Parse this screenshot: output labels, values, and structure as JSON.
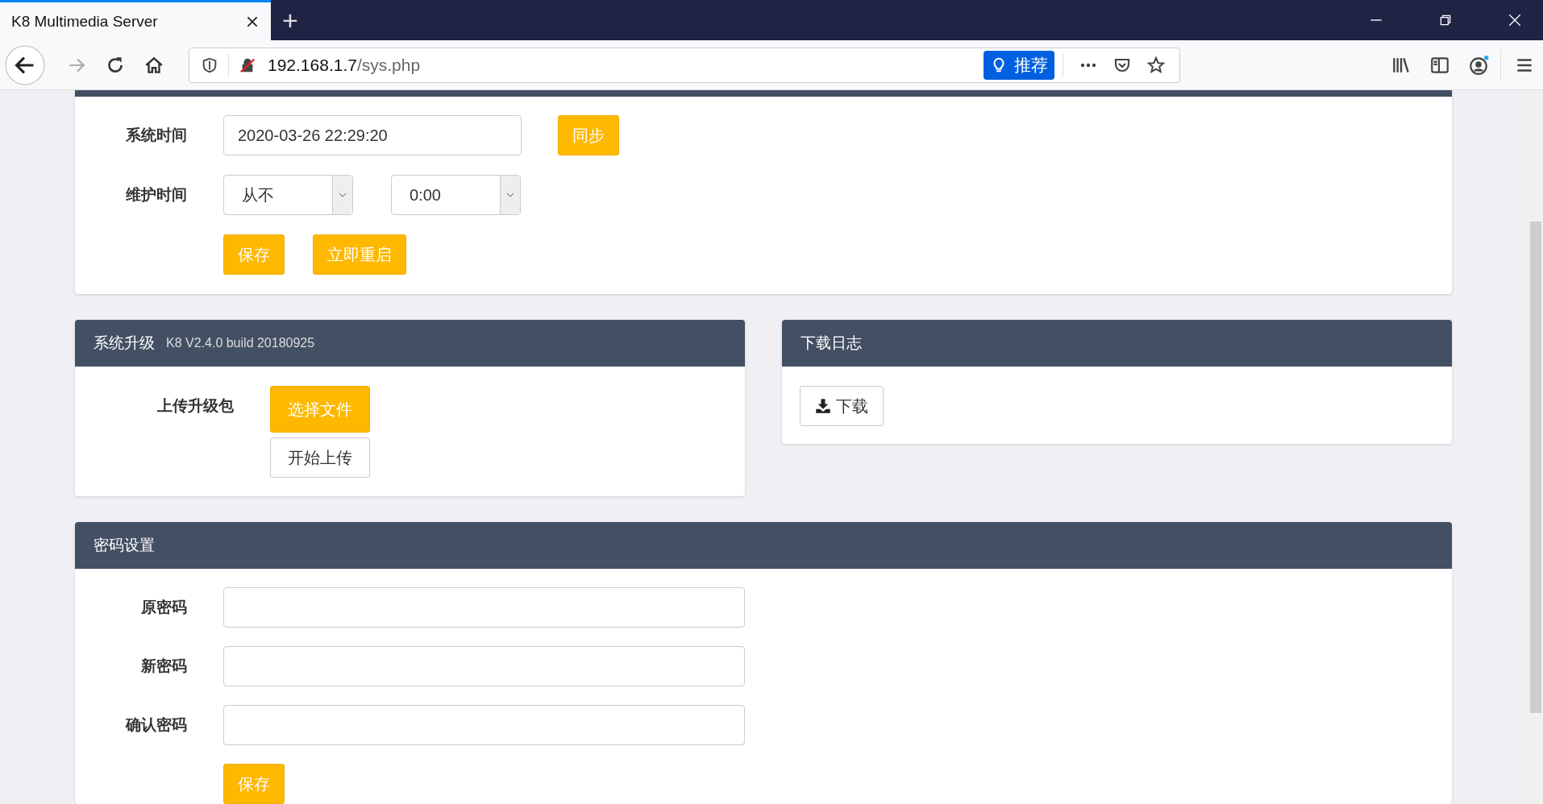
{
  "browser": {
    "tab_title": "K8 Multimedia Server",
    "url_host": "192.168.1.7",
    "url_path": "/sys.php",
    "recommend_label": "推荐",
    "new_tab": "+"
  },
  "system": {
    "time_label": "系统时间",
    "time_value": "2020-03-26 22:29:20",
    "sync_button": "同步",
    "maintenance_label": "维护时间",
    "maintenance_day": "从不",
    "maintenance_hour": "0:00",
    "buttons": [
      "保存",
      "立即重启"
    ]
  },
  "upgrade": {
    "title": "系统升级",
    "version": "K8 V2.4.0 build 20180925",
    "upload_label": "上传升级包",
    "choose_button": "选择文件",
    "start_button": "开始上传"
  },
  "log": {
    "title": "下载日志",
    "download_button": "下载"
  },
  "password": {
    "title": "密码设置",
    "fields": [
      {
        "label": "原密码"
      },
      {
        "label": "新密码"
      },
      {
        "label": "确认密码"
      }
    ],
    "save_button": "保存"
  }
}
